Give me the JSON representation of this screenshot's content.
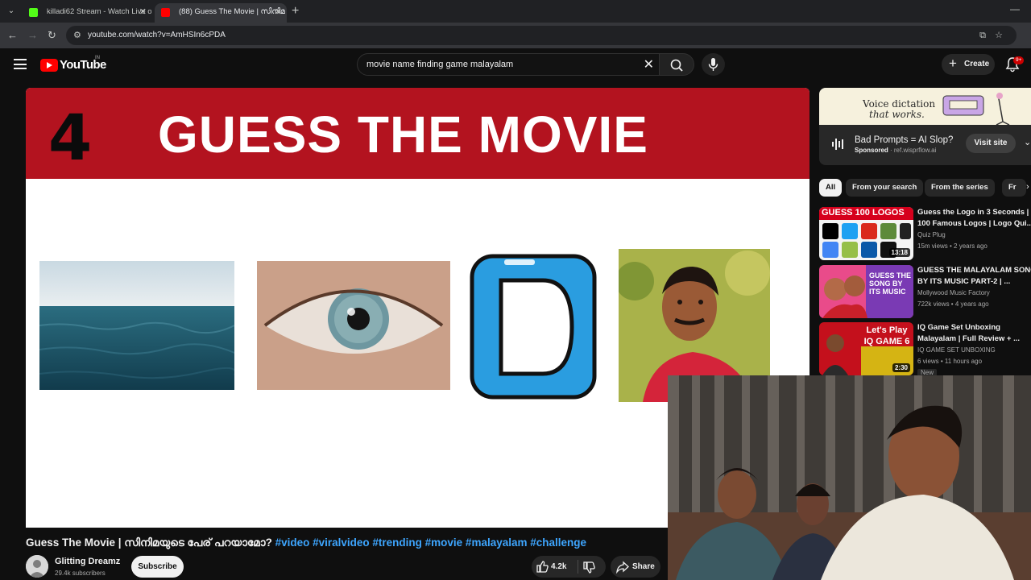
{
  "browser": {
    "tabs": [
      {
        "title": "killadi62 Stream - Watch Live o",
        "favicon_color": "#53fc18"
      },
      {
        "title": "(88) Guess The Movie | സിനിമ",
        "favicon_color": "#ff0000"
      }
    ],
    "url": "youtube.com/watch?v=AmHSIn6cPDA"
  },
  "youtube": {
    "logo_text": "YouTube",
    "country_code": "IN",
    "search_query": "movie name finding game malayalam",
    "create_label": "Create",
    "notification_count": "9+"
  },
  "video": {
    "clue_number": "4",
    "banner_text": "GUESS THE MOVIE",
    "clue_letter": "D",
    "title": "Guess The Movie | സിനിമയുടെ പേര് പറയാമോ?",
    "hashtags": "#video #viralvideo #trending #movie #malayalam #challenge",
    "channel": "Glitting Dreamz",
    "subscribers": "29.4k subscribers",
    "subscribe_label": "Subscribe",
    "likes": "4.2k",
    "share_label": "Share"
  },
  "ad": {
    "slogan_line1": "Voice dictation",
    "slogan_line2": "that works.",
    "title": "Bad Prompts = AI Slop?",
    "sponsored": "Sponsored",
    "domain": "ref.wisprflow.ai",
    "visit_label": "Visit site"
  },
  "chips": [
    "All",
    "From your search",
    "From the series",
    "Fr"
  ],
  "recommendations": [
    {
      "title1": "Guess the Logo in 3 Seconds |",
      "title2": "100 Famous Logos | Logo Qui...",
      "channel": "Quiz Plug",
      "meta": "15m views • 2 years ago",
      "duration": "13:18",
      "thumb_text": "GUESS 100 LOGOS"
    },
    {
      "title1": "GUESS THE MALAYALAM SONG",
      "title2": "BY ITS MUSIC PART-2 | ...",
      "channel": "Mollywood Music Factory",
      "meta": "722k views • 4 years ago",
      "duration": "",
      "thumb_text": "GUESS THE SONG BY ITS MUSIC"
    },
    {
      "title1": "IQ Game Set Unboxing",
      "title2": "Malayalam | Full Review + ...",
      "channel": "IQ GAME SET UNBOXING",
      "meta": "6 views • 11 hours ago",
      "duration": "2:30",
      "badge": "New",
      "thumb_text": "Let's Play IQ GAME 6"
    }
  ],
  "colors": {
    "accent": "#ff0000",
    "banner": "#b3131f",
    "link": "#3ea6ff",
    "clue_blue": "#2a9de0"
  }
}
